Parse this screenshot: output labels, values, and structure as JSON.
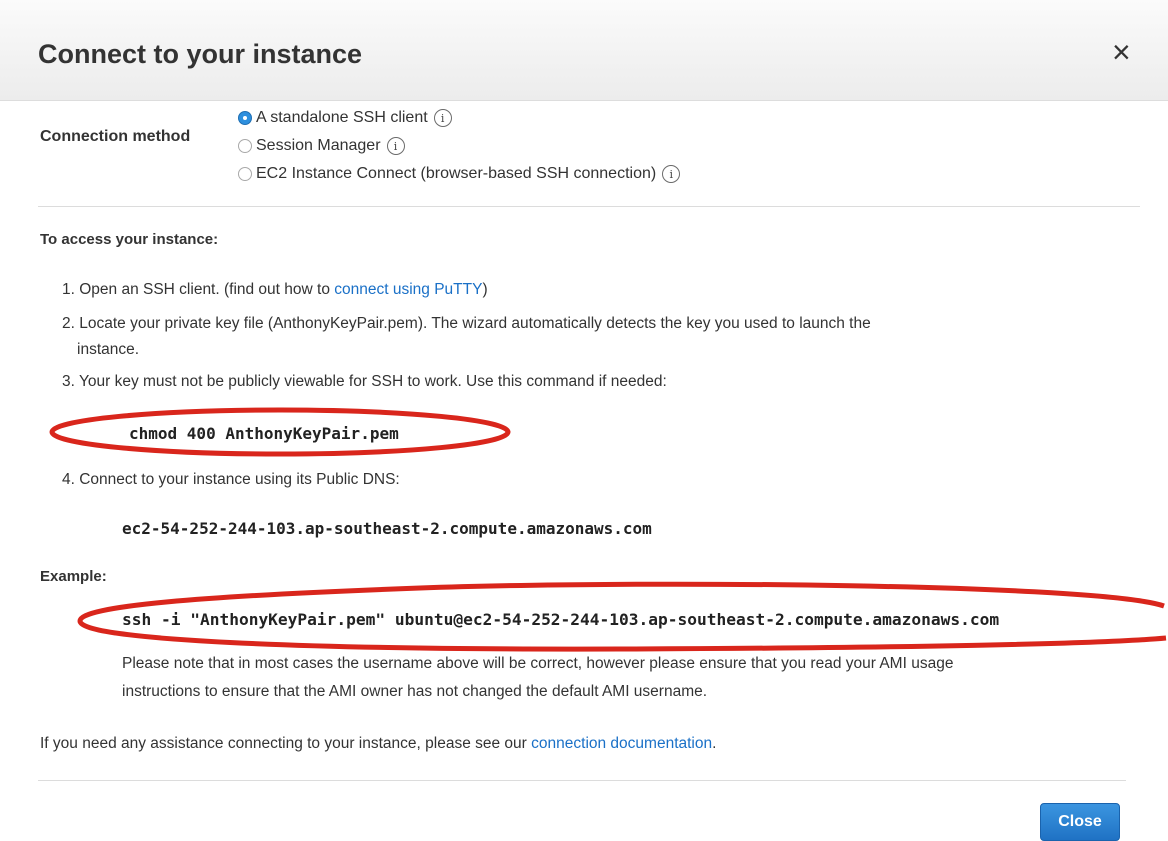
{
  "dialog": {
    "title": "Connect to your instance",
    "close_glyph": "×"
  },
  "connection_method": {
    "label": "Connection method",
    "options": [
      {
        "label": "A standalone SSH client",
        "selected": true
      },
      {
        "label": "Session Manager",
        "selected": false
      },
      {
        "label": "EC2 Instance Connect (browser-based SSH connection)",
        "selected": false
      }
    ],
    "info_glyph": "i"
  },
  "access": {
    "title": "To access your instance:",
    "step1_text": "1. Open an SSH client. (find out how to ",
    "step1_link": "connect using PuTTY",
    "step1_end": ")",
    "step2_line1": "2. Locate your private key file (AnthonyKeyPair.pem). The wizard automatically detects the key you used to launch the",
    "step2_line2": "instance.",
    "step3": "3. Your key must not be publicly viewable for SSH to work. Use this command if needed:",
    "chmod_command": "chmod 400 AnthonyKeyPair.pem",
    "step4": "4. Connect to your instance using its Public DNS:",
    "public_dns": "ec2-54-252-244-103.ap-southeast-2.compute.amazonaws.com"
  },
  "example": {
    "title": "Example:",
    "ssh_command": "ssh -i \"AnthonyKeyPair.pem\" ubuntu@ec2-54-252-244-103.ap-southeast-2.compute.amazonaws.com",
    "note_line1": "Please note that in most cases the username above will be correct, however please ensure that you read your AMI usage",
    "note_line2": "instructions to ensure that the AMI owner has not changed the default AMI username."
  },
  "assistance": {
    "text": "If you need any assistance connecting to your instance, please see our ",
    "link": "connection documentation",
    "end": "."
  },
  "footer": {
    "close_label": "Close"
  },
  "colors": {
    "link": "#1a70c7",
    "primary_button": "#1f72c4",
    "annotation_ring": "#d9261c"
  }
}
